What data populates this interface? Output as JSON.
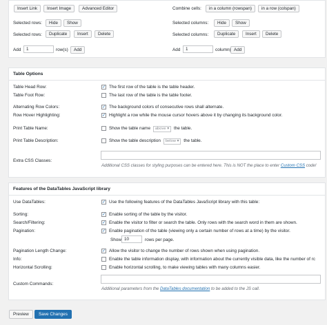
{
  "toolbar": {
    "insert_link": "Insert Link",
    "insert_image": "Insert Image",
    "advanced_editor": "Advanced Editor",
    "combine_cells_label": "Combine cells:",
    "in_column": "in a column (rowspan)",
    "in_row": "in a row (colspan)",
    "selected_rows_label": "Selected rows:",
    "selected_columns_label": "Selected columns:",
    "hide": "Hide",
    "show": "Show",
    "duplicate": "Duplicate",
    "insert": "Insert",
    "delete": "Delete",
    "add_label": "Add",
    "rows_value": "1",
    "rows_suffix": "row(s)",
    "columns_value": "1",
    "columns_suffix": "column(s)",
    "add_button": "Add"
  },
  "table_options": {
    "title": "Table Options",
    "head_row_label": "Table Head Row:",
    "head_row_text": "The first row of the table is the table header.",
    "head_row_checked": true,
    "foot_row_label": "Table Foot Row:",
    "foot_row_text": "The last row of the table is the table footer.",
    "foot_row_checked": false,
    "alt_colors_label": "Alternating Row Colors:",
    "alt_colors_text": "The background colors of consecutive rows shall alternate.",
    "alt_colors_checked": true,
    "hover_label": "Row Hover Highlighting:",
    "hover_text": "Highlight a row while the mouse cursor hovers above it by changing its background color.",
    "hover_checked": true,
    "print_name_label": "Print Table Name:",
    "print_name_text_before": "Show the table name",
    "print_name_select": "above",
    "print_name_text_after": "the table.",
    "print_name_checked": false,
    "print_desc_label": "Print Table Description:",
    "print_desc_text_before": "Show the table description",
    "print_desc_select": "below",
    "print_desc_text_after": "the table.",
    "print_desc_checked": false,
    "css_label": "Extra CSS Classes:",
    "css_help_before": "Additional CSS classes for styling purposes can be entered here. This is NOT the place to enter ",
    "css_help_link": "Custom CSS",
    "css_help_after": " code!"
  },
  "datatables": {
    "title": "Features of the DataTables JavaScript library",
    "use_label": "Use DataTables:",
    "use_text": "Use the following features of the DataTables JavaScript library with this table:",
    "use_checked": true,
    "sorting_label": "Sorting:",
    "sorting_text": "Enable sorting of the table by the visitor.",
    "sorting_checked": true,
    "search_label": "Search/Filtering:",
    "search_text": "Enable the visitor to filter or search the table. Only rows with the search word in them are shown.",
    "search_checked": true,
    "pagination_label": "Pagination:",
    "pagination_text": "Enable pagination of the table (viewing only a certain number of rows at a time) by the visitor.",
    "pagination_checked": true,
    "show_label": "Show",
    "rows_per_page_value": "10",
    "rows_per_page_suffix": "rows per page.",
    "length_label": "Pagination Length Change:",
    "length_text": "Allow the visitor to change the number of rows shown when using pagination.",
    "length_checked": true,
    "info_label": "Info:",
    "info_text": "Enable the table information display, with information about the currently visible data, like the number of rc",
    "info_checked": false,
    "hscroll_label": "Horizontal Scrolling:",
    "hscroll_text": "Enable horizontal scrolling, to make viewing tables with many columns easier.",
    "hscroll_checked": false,
    "custom_label": "Custom Commands:",
    "custom_help_before": "Additional parameters from the ",
    "custom_help_link": "DataTables documentation",
    "custom_help_after": " to be added to the JS call."
  },
  "footer": {
    "preview": "Preview",
    "save": "Save Changes"
  },
  "colors": {
    "accent": "#2271b1",
    "background": "#f1f1f1"
  },
  "icons": {
    "checkmark": "✓"
  }
}
